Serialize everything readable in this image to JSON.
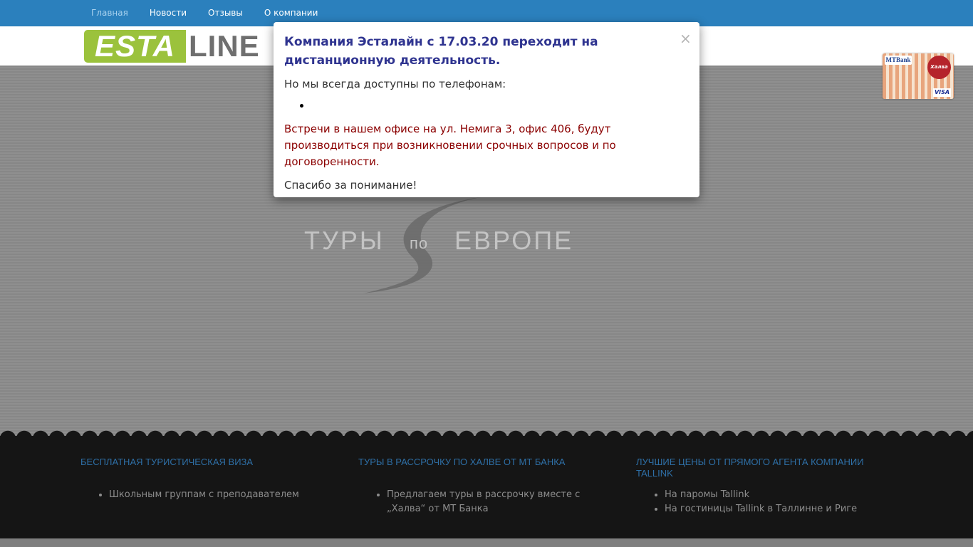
{
  "nav": {
    "items": [
      {
        "label": "Главная",
        "active": true
      },
      {
        "label": "Новости"
      },
      {
        "label": "Отзывы"
      },
      {
        "label": "О компании"
      }
    ]
  },
  "logo": {
    "part1": "ESTA",
    "part2": "LINE"
  },
  "hero": {
    "word1": "ТУРЫ",
    "word2": "по",
    "word3": "ЕВРОПЕ"
  },
  "card": {
    "bank": "MTBank",
    "seal": "Халва",
    "network": "VISA"
  },
  "modal": {
    "title": "Компания Эсталайн с 17.03.20 переходит на дистанционную деятельность.",
    "phones_intro": "Но мы всегда доступны по телефонам:",
    "phones": [
      ""
    ],
    "office_note": "Встречи в нашем офисе на ул. Немига 3, офис 406, будут производиться при возникновении срочных вопросов и по договоренности.",
    "thanks": "Спасибо за понимание!",
    "close_label": "×"
  },
  "footer": {
    "columns": [
      {
        "title": "Бесплатная туристическая виза",
        "items": [
          "Школьным группам с преподавателем"
        ]
      },
      {
        "title": "Туры в рассрочку по Халве от МТ Банка",
        "items": [
          "Предлагаем туры в рассрочку вместе с „Халва“ от МТ Банка"
        ]
      },
      {
        "title": "Лучшие цены от прямого агента компании Tallink",
        "items": [
          "На паромы Tallink",
          "На гостиницы Tallink в Таллинне и Риге"
        ]
      }
    ]
  },
  "colors": {
    "nav_bg": "#2b80bd",
    "logo_green": "#9bc23c",
    "modal_title": "#2f3490",
    "modal_warning": "#8b0000",
    "footer_heading": "#2e6fa6",
    "footer_bg": "#151515"
  }
}
